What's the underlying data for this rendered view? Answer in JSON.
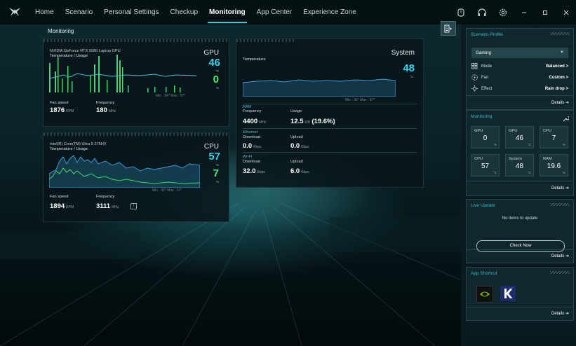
{
  "nav": {
    "logo": "predator-logo-icon",
    "tabs": [
      "Home",
      "Scenario",
      "Personal Settings",
      "Checkup",
      "Monitoring",
      "App Center",
      "Experience Zone"
    ],
    "active_tab": "Monitoring",
    "controls": [
      "gamepad-icon",
      "headset-icon",
      "settings-icon",
      "minimize-icon",
      "maximize-icon",
      "close-icon"
    ]
  },
  "page_title": "Monitoring",
  "gpu_card": {
    "device": "NVIDIA GeForce RTX 5080 Laptop GPU",
    "subtitle": "Temperature / Usage",
    "tag": "GPU",
    "temp": "46",
    "temp_unit": "°C",
    "usage": "0",
    "usage_unit": "%",
    "minmax": "Min : 34°   Max : 57°",
    "fan_label": "Fan speed",
    "fan_value": "1876",
    "fan_unit": "RPM",
    "freq_label": "Frequency",
    "freq_value": "180",
    "freq_unit": "MHz"
  },
  "cpu_card": {
    "device": "Intel(R) Core(TM) Ultra 9 275HX",
    "subtitle": "Temperature / Usage",
    "tag": "CPU",
    "temp": "57",
    "temp_unit": "°C",
    "usage": "7",
    "usage_unit": "%",
    "minmax": "Min : 42°   Max : 57°",
    "fan_label": "Fan speed",
    "fan_value": "1894",
    "fan_unit": "RPM",
    "freq_label": "Frequency",
    "freq_value": "3111",
    "freq_unit": "MHz",
    "info_icon": "info-icon"
  },
  "system_card": {
    "tag": "System",
    "subtitle": "Temperature",
    "temp": "48",
    "temp_unit": "°C",
    "minmax": "Min : 36°   Max : 57°",
    "ram": {
      "title": "RAM",
      "freq_label": "Frequency",
      "freq_value": "4400",
      "freq_unit": "MHz",
      "usage_label": "Usage",
      "usage_value": "12.5",
      "usage_unit": "GB",
      "usage_pct": "(19.6%)"
    },
    "ethernet": {
      "title": "Ethernet",
      "down_label": "Download",
      "down_value": "0.0",
      "down_unit": "Kbps",
      "up_label": "Upload",
      "up_value": "0.0",
      "up_unit": "Kbps"
    },
    "wifi": {
      "title": "Wi-Fi",
      "down_label": "Download",
      "down_value": "32.0",
      "down_unit": "Kbps",
      "up_label": "Upload",
      "up_value": "6.0",
      "up_unit": "Kbps"
    }
  },
  "right_panel": {
    "collapse_icon": "panel-collapse-icon",
    "scenario": {
      "title": "Scenario Profile",
      "profile": "Gaming",
      "rows": [
        {
          "icon": "mode-icon",
          "label": "Mode",
          "value": "Balanced >"
        },
        {
          "icon": "fan-icon",
          "label": "Fan",
          "value": "Custom >"
        },
        {
          "icon": "effect-icon",
          "label": "Effect",
          "value": "Rain drop >"
        }
      ],
      "details": "Details ➔"
    },
    "monitoring": {
      "title": "Monitoring",
      "tiles": [
        {
          "label": "GPU",
          "value": "0",
          "unit": "%"
        },
        {
          "label": "GPU",
          "value": "46",
          "unit": "°C"
        },
        {
          "label": "CPU",
          "value": "7",
          "unit": "%"
        },
        {
          "label": "CPU",
          "value": "57",
          "unit": "°C"
        },
        {
          "label": "System",
          "value": "48",
          "unit": "°C"
        },
        {
          "label": "RAM",
          "value": "19.6",
          "unit": "%"
        }
      ],
      "details": "Details ➔"
    },
    "live_update": {
      "title": "Live Update",
      "message": "No items to update",
      "button": "Check Now",
      "details": "Details ➔"
    },
    "app_shortcut": {
      "title": "App Shortcut",
      "apps": [
        "nvidia-icon",
        "killer-icon"
      ],
      "details": "Details ➔"
    }
  },
  "colors": {
    "accent": "#2fd0e0",
    "temp_value": "#3ad2ee",
    "usage_value": "#52e86c",
    "panel_title": "#37bdd0"
  }
}
